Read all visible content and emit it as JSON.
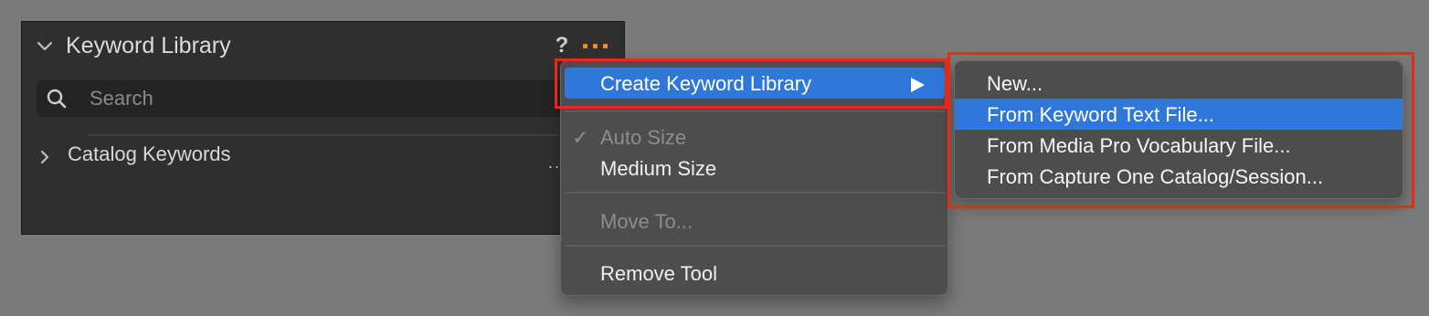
{
  "panel": {
    "title": "Keyword Library",
    "help_label": "?",
    "search_placeholder": "Search",
    "catalog_item_label": "Catalog Keywords",
    "catalog_item_more": "..",
    "more_icon_color": "#f08a24"
  },
  "menu": {
    "items": [
      {
        "label": "Create Keyword Library",
        "state": "highlighted",
        "has_submenu": true
      },
      {
        "label": "Auto Size",
        "state": "disabled",
        "checked": true
      },
      {
        "label": "Medium Size",
        "state": "enabled"
      },
      {
        "label": "Move To...",
        "state": "disabled"
      },
      {
        "label": "Remove Tool",
        "state": "enabled"
      }
    ],
    "check_glyph": "✓"
  },
  "submenu": {
    "items": [
      {
        "label": "New...",
        "state": "enabled"
      },
      {
        "label": "From Keyword Text File...",
        "state": "highlighted"
      },
      {
        "label": "From Media Pro Vocabulary File...",
        "state": "enabled"
      },
      {
        "label": "From Capture One Catalog/Session...",
        "state": "enabled"
      }
    ]
  },
  "colors": {
    "background": "#7a7a7a",
    "panel": "#2f2f2f",
    "menu": "#4d4d4d",
    "highlight": "#2f78d9",
    "annotation": "#e52b17"
  }
}
